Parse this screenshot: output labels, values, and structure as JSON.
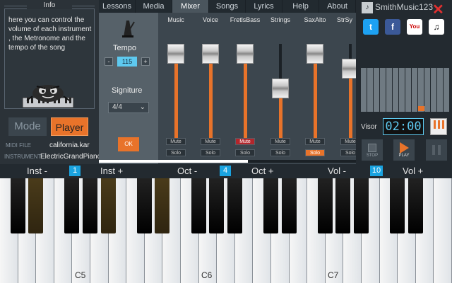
{
  "tabs": [
    "Lessons",
    "Media",
    "Mixer",
    "Songs",
    "Lyrics",
    "Help",
    "About"
  ],
  "active_tab": "Mixer",
  "info": {
    "title": "Info",
    "text": "here you can control the volume of each instrument , the Metronome and the tempo of the song"
  },
  "mode_label": "Mode",
  "player_label": "Player",
  "midi_file_label": "MIDI FILE",
  "midi_file_value": "california.kar",
  "instrument_label": "INSTRUMENT",
  "instrument_value": "ElectricGrandPiano",
  "tempo": {
    "label": "Tempo",
    "value": "115",
    "minus": "-",
    "plus": "+"
  },
  "signature": {
    "label": "Signiture",
    "value": "4/4"
  },
  "ok_label": "OK",
  "channels": [
    {
      "name": "Music",
      "level": 0.9,
      "mute": false,
      "solo": false
    },
    {
      "name": "Voice",
      "level": 0.9,
      "mute": false,
      "solo": false
    },
    {
      "name": "FretlsBass",
      "level": 0.9,
      "mute": true,
      "solo": false
    },
    {
      "name": "Strings",
      "level": 0.55,
      "mute": false,
      "solo": false
    },
    {
      "name": "SaxAlto",
      "level": 0.9,
      "mute": false,
      "solo": true
    },
    {
      "name": "StrSy",
      "level": 0.75,
      "mute": false,
      "solo": false
    }
  ],
  "mute_label": "Mute",
  "solo_label": "Solo",
  "song_progress": 0.58,
  "logo": "SmithMusic123",
  "social": [
    {
      "name": "twitter-icon",
      "glyph": "t",
      "bg": "#1da1f2"
    },
    {
      "name": "facebook-icon",
      "glyph": "f",
      "bg": "#3b5998"
    },
    {
      "name": "youtube-icon",
      "glyph": "You",
      "bg": "#ffffff"
    },
    {
      "name": "piano-app-icon",
      "glyph": "♫",
      "bg": "#ffffff"
    }
  ],
  "visor_label": "Visor",
  "time": "02:00",
  "stop_label": "STOP",
  "play_label": "PLAY",
  "keyboard": {
    "inst_minus": "Inst -",
    "inst_value": "1",
    "inst_plus": "Inst +",
    "oct_minus": "Oct -",
    "oct_value": "4",
    "oct_plus": "Oct +",
    "vol_minus": "Vol -",
    "vol_value": "10",
    "vol_plus": "Vol +",
    "labels": [
      "C5",
      "C6",
      "C7"
    ]
  },
  "colors": {
    "accent": "#e8732a",
    "highlight": "#1aa3e0",
    "mute_on": "#b3262c"
  }
}
